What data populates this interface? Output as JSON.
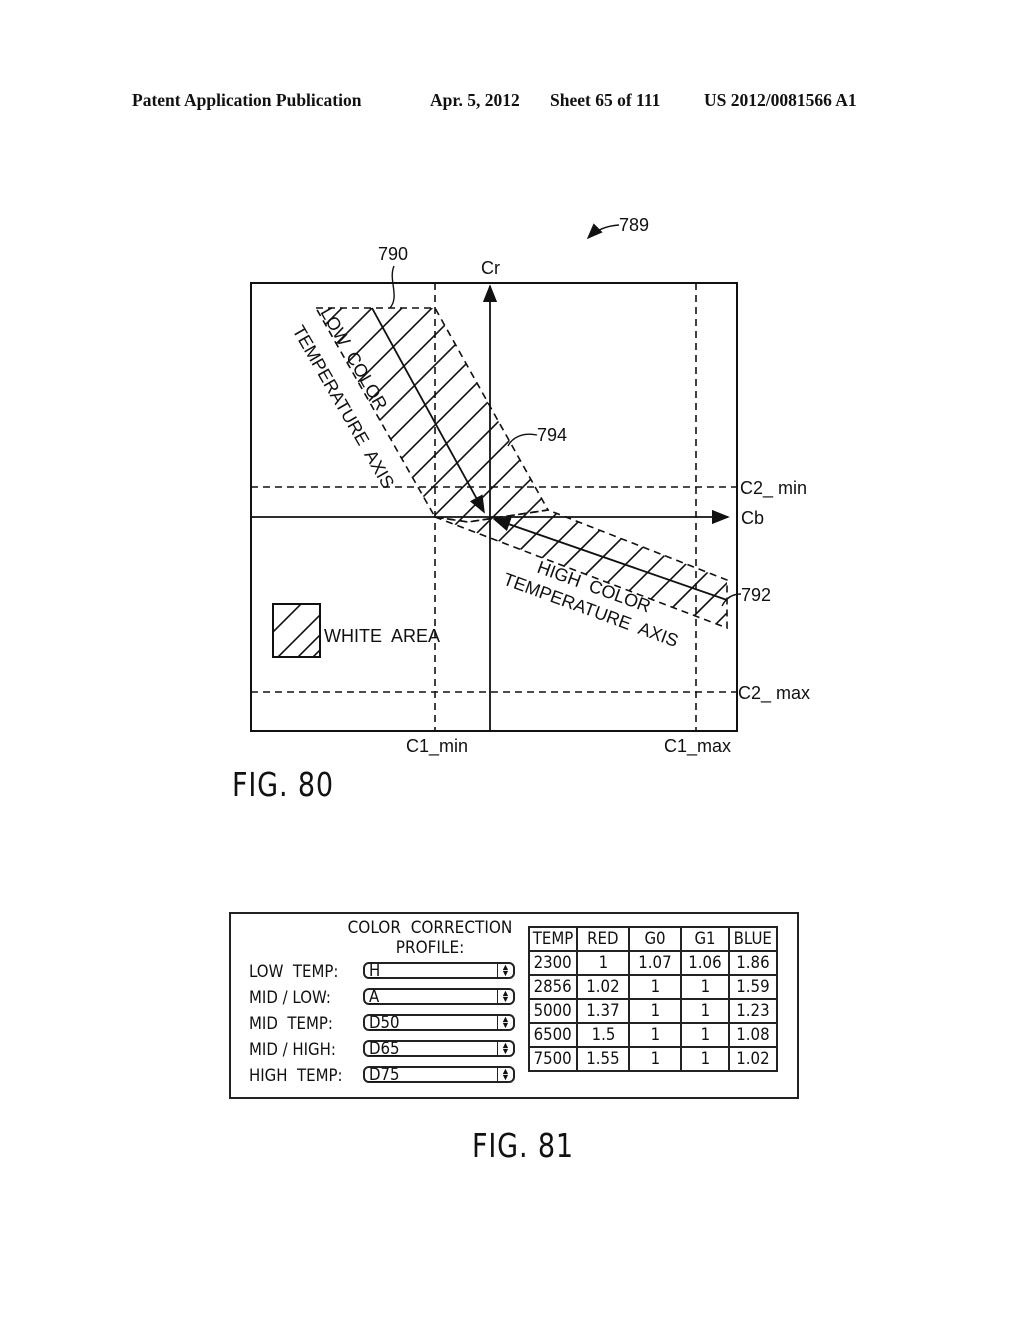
{
  "header": {
    "publication": "Patent Application Publication",
    "date": "Apr. 5, 2012",
    "sheet": "Sheet 65 of 111",
    "number": "US 2012/0081566 A1"
  },
  "fig80": {
    "ref_figure": "789",
    "ref_low_region": "790",
    "ref_high_region": "792",
    "ref_transition": "794",
    "axis_vertical": "Cr",
    "axis_horizontal": "Cb",
    "c2_min": "C2_ min",
    "c2_max": "C2_ max",
    "c1_min": "C1_min",
    "c1_max": "C1_max",
    "low_axis_line1": "LOW  COLOR",
    "low_axis_line2": "TEMPERATURE  AXIS",
    "high_axis_line1": "HIGH  COLOR",
    "high_axis_line2": "TEMPERATURE  AXIS",
    "legend_label": "WHITE  AREA",
    "caption": "FIG. 80"
  },
  "fig81": {
    "profile_title_line1": "COLOR  CORRECTION",
    "profile_title_line2": "PROFILE:",
    "profiles": [
      {
        "label": "LOW  TEMP:",
        "value": "H"
      },
      {
        "label": "MID / LOW:",
        "value": "A"
      },
      {
        "label": "MID  TEMP:",
        "value": "D50"
      },
      {
        "label": "MID / HIGH:",
        "value": "D65"
      },
      {
        "label": "HIGH  TEMP:",
        "value": "D75"
      }
    ],
    "table": {
      "headers": [
        "TEMP",
        "RED",
        "G0",
        "G1",
        "BLUE"
      ],
      "rows": [
        [
          "2300",
          "1",
          "1.07",
          "1.06",
          "1.86"
        ],
        [
          "2856",
          "1.02",
          "1",
          "1",
          "1.59"
        ],
        [
          "5000",
          "1.37",
          "1",
          "1",
          "1.23"
        ],
        [
          "6500",
          "1.5",
          "1",
          "1",
          "1.08"
        ],
        [
          "7500",
          "1.55",
          "1",
          "1",
          "1.02"
        ]
      ]
    },
    "caption": "FIG. 81"
  }
}
